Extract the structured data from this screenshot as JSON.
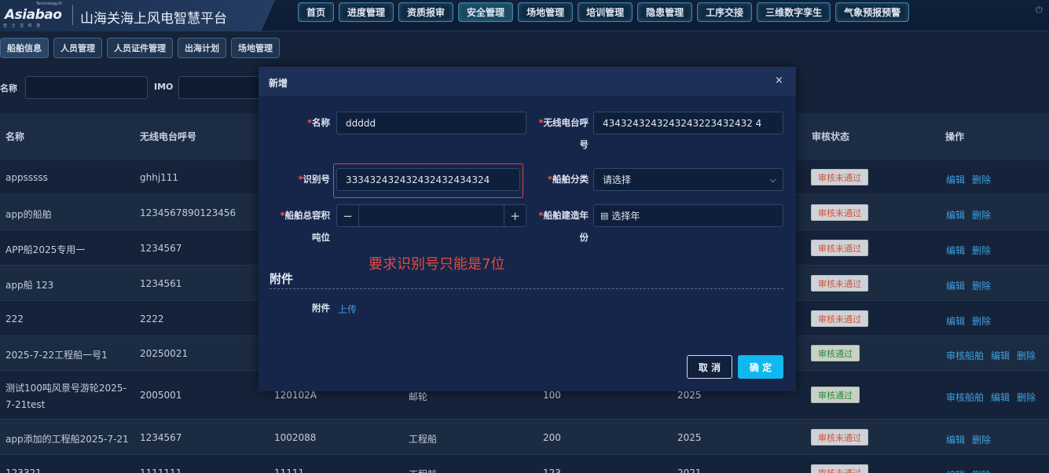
{
  "header": {
    "logo_text": "Asiabao",
    "logo_tm": "Technology®",
    "logo_sub": "亚 士 宝 科 技",
    "platform_title": "山海关海上风电智慧平台",
    "nav": [
      {
        "label": "首页",
        "active": false
      },
      {
        "label": "进度管理",
        "active": false
      },
      {
        "label": "资质报审",
        "active": false
      },
      {
        "label": "安全管理",
        "active": true
      },
      {
        "label": "场地管理",
        "active": false
      },
      {
        "label": "培训管理",
        "active": false
      },
      {
        "label": "隐患管理",
        "active": false
      },
      {
        "label": "工序交接",
        "active": false
      },
      {
        "label": "三维数字孪生",
        "active": false
      },
      {
        "label": "气象预报预警",
        "active": false
      }
    ]
  },
  "subnav": [
    {
      "label": "船舶信息",
      "active": true
    },
    {
      "label": "人员管理",
      "active": false
    },
    {
      "label": "人员证件管理",
      "active": false
    },
    {
      "label": "出海计划",
      "active": false
    },
    {
      "label": "场地管理",
      "active": false
    }
  ],
  "search": {
    "name_label": "名称",
    "imo_label": "IMO"
  },
  "table": {
    "headers": [
      "名称",
      "无线电台呼号",
      "审核状态",
      "操作"
    ],
    "rows": [
      {
        "name": "appsssss",
        "callsign": "ghhj111",
        "col3": "",
        "col4": "",
        "col5": "",
        "col6": "",
        "status": "审核未通过",
        "ops": [
          "编辑",
          "删除"
        ]
      },
      {
        "name": "app的船舶",
        "callsign": "1234567890123456",
        "col3": "",
        "col4": "",
        "col5": "",
        "col6": "",
        "status": "审核未通过",
        "ops": [
          "编辑",
          "删除"
        ]
      },
      {
        "name": "APP船2025专用一",
        "callsign": "1234567",
        "col3": "",
        "col4": "",
        "col5": "",
        "col6": "",
        "status": "审核未通过",
        "ops": [
          "编辑",
          "删除"
        ]
      },
      {
        "name": "app船 123",
        "callsign": "1234561",
        "col3": "",
        "col4": "",
        "col5": "",
        "col6": "",
        "status": "审核未通过",
        "ops": [
          "编辑",
          "删除"
        ]
      },
      {
        "name": "222",
        "callsign": "2222",
        "col3": "",
        "col4": "",
        "col5": "",
        "col6": "",
        "status": "审核未通过",
        "ops": [
          "编辑",
          "删除"
        ]
      },
      {
        "name": "2025-7-22工程船一号1",
        "callsign": "20250021",
        "col3": "",
        "col4": "",
        "col5": "",
        "col6": "",
        "status": "审核通过",
        "ops": [
          "审核船舶",
          "编辑",
          "删除"
        ]
      },
      {
        "name": "测试100吨风景号游轮2025-7-21test",
        "callsign": "2005001",
        "col3": "120102A",
        "col4": "邮轮",
        "col5": "100",
        "col6": "2025",
        "status": "审核通过",
        "ops": [
          "审核船舶",
          "编辑",
          "删除"
        ]
      },
      {
        "name": "app添加的工程船2025-7-21",
        "callsign": "1234567",
        "col3": "1002088",
        "col4": "工程船",
        "col5": "200",
        "col6": "2025",
        "status": "审核未通过",
        "ops": [
          "编辑",
          "删除"
        ]
      },
      {
        "name": "123321",
        "callsign": "1111111",
        "col3": "11111",
        "col4": "工程船",
        "col5": "123",
        "col6": "2021",
        "status": "审核未通过",
        "ops": [
          "编辑",
          "删除"
        ]
      }
    ]
  },
  "modal": {
    "title": "新增",
    "close": "×",
    "name_label": "名称",
    "name_value": "ddddd",
    "callsign_label_1": "无线电台呼",
    "callsign_label_2": "号",
    "callsign_value": "4343243243243243223432432 4",
    "id_label": "识别号",
    "id_value": "333432432432432432434324",
    "category_label": "船舶分类",
    "category_value": "请选择",
    "tonnage_label_1": "船舶总容积",
    "tonnage_label_2": "吨位",
    "stepper_minus": "−",
    "stepper_plus": "+",
    "year_label_1": "船舶建造年",
    "year_label_2": "份",
    "year_placeholder": "选择年",
    "annotation": "要求识别号只能是7位",
    "attachment_section": "附件",
    "attachment_label": "附件",
    "upload_label": "上传",
    "cancel_label": "取 消",
    "ok_label": "确 定"
  },
  "colors": {
    "accent": "#10b8ef",
    "error": "#e8483d",
    "link": "#3fa0e0"
  }
}
